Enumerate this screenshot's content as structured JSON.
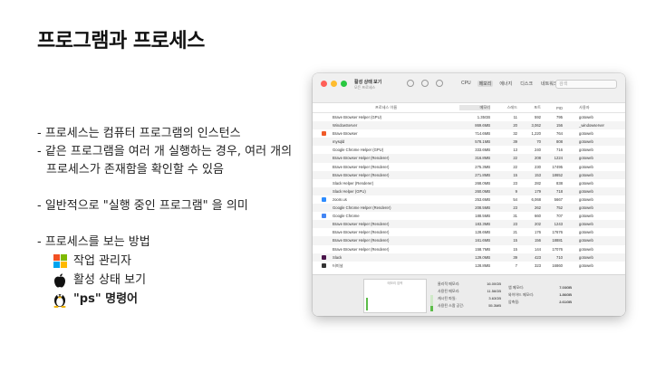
{
  "slide": {
    "title": "프로그램과 프로세스",
    "bullets": [
      "- 프로세스는 컴퓨터 프로그램의 인스턴스",
      "- 같은 프로그램을 여러 개 실행하는 경우, 여러 개의",
      "프로세스가 존재함을 확인할 수 있음",
      "- 일반적으로 \"실행 중인 프로그램\" 을 의미",
      "- 프로세스를 보는 방법"
    ],
    "methods": [
      {
        "icon": "windows-logo-icon",
        "label": "작업 관리자"
      },
      {
        "icon": "apple-logo-icon",
        "label": "활성 상태 보기"
      },
      {
        "icon": "linux-tux-icon",
        "label": "\"ps\" 명령어"
      }
    ]
  },
  "window": {
    "title": "활성 상태 보기",
    "subtitle": "모든 프로세스",
    "tabs": [
      "CPU",
      "메모리",
      "에너지",
      "디스크",
      "네트워크"
    ],
    "active_tab": "메모리",
    "search_placeholder": "검색",
    "columns": [
      "프로세스 이름",
      "메모리",
      "스레드",
      "포트",
      "PID",
      "사용자"
    ],
    "rows": [
      [
        "Brave Browser Helper (GPU)",
        "1.35GB",
        "11",
        "592",
        "795",
        "gotoweb"
      ],
      [
        "WindowServer",
        "869.6MB",
        "20",
        "3,062",
        "156",
        "_windowserver"
      ],
      [
        "Brave Browser",
        "714.6MB",
        "32",
        "1,220",
        "764",
        "gotoweb"
      ],
      [
        "mysqld",
        "578.1MB",
        "39",
        "70",
        "808",
        "gotoweb"
      ],
      [
        "Google Chrome Helper (GPU)",
        "333.6MB",
        "13",
        "240",
        "716",
        "gotoweb"
      ],
      [
        "Brave Browser Helper (Renderer)",
        "316.8MB",
        "22",
        "208",
        "1224",
        "gotoweb"
      ],
      [
        "Brave Browser Helper (Renderer)",
        "275.3MB",
        "22",
        "230",
        "17495",
        "gotoweb"
      ],
      [
        "Brave Browser Helper (Renderer)",
        "271.8MB",
        "15",
        "153",
        "18652",
        "gotoweb"
      ],
      [
        "Slack Helper (Renderer)",
        "268.0MB",
        "23",
        "282",
        "838",
        "gotoweb"
      ],
      [
        "Slack Helper (GPU)",
        "260.0MB",
        "9",
        "179",
        "718",
        "gotoweb"
      ],
      [
        "zoom.us",
        "253.6MB",
        "54",
        "6,068",
        "5667",
        "gotoweb"
      ],
      [
        "Google Chrome Helper (Renderer)",
        "208.5MB",
        "23",
        "262",
        "752",
        "gotoweb"
      ],
      [
        "Google Chrome",
        "188.5MB",
        "31",
        "660",
        "707",
        "gotoweb"
      ],
      [
        "Brave Browser Helper (Renderer)",
        "183.3MB",
        "23",
        "202",
        "1243",
        "gotoweb"
      ],
      [
        "Brave Browser Helper (Renderer)",
        "128.6MB",
        "21",
        "176",
        "17676",
        "gotoweb"
      ],
      [
        "Brave Browser Helper (Renderer)",
        "161.6MB",
        "15",
        "156",
        "18881",
        "gotoweb"
      ],
      [
        "Brave Browser Helper (Renderer)",
        "158.7MB",
        "15",
        "144",
        "17076",
        "gotoweb"
      ],
      [
        "Slack",
        "129.0MB",
        "39",
        "423",
        "710",
        "gotoweb"
      ],
      [
        "터미널",
        "128.8MB",
        "7",
        "323",
        "16860",
        "gotoweb"
      ]
    ],
    "footer": {
      "graph_label": "메모리 압력",
      "stats": [
        [
          "물리적 메모리:",
          "16.00GB"
        ],
        [
          "사용된 메모리:",
          "11.56GB"
        ],
        [
          "캐시된 파일:",
          "3.63GB"
        ],
        [
          "사용된 스왑 공간:",
          "55.3MB"
        ]
      ],
      "stats2": [
        [
          "앱 메모리:",
          "7.03GB"
        ],
        [
          "와이어드 메모리:",
          "1.86GB"
        ],
        [
          "압축됨:",
          "2.61GB"
        ]
      ]
    },
    "colors": {
      "close": "#ff5f57",
      "minimize": "#febc2e",
      "zoom": "#28c840",
      "pressure": "#5cbc49"
    }
  }
}
